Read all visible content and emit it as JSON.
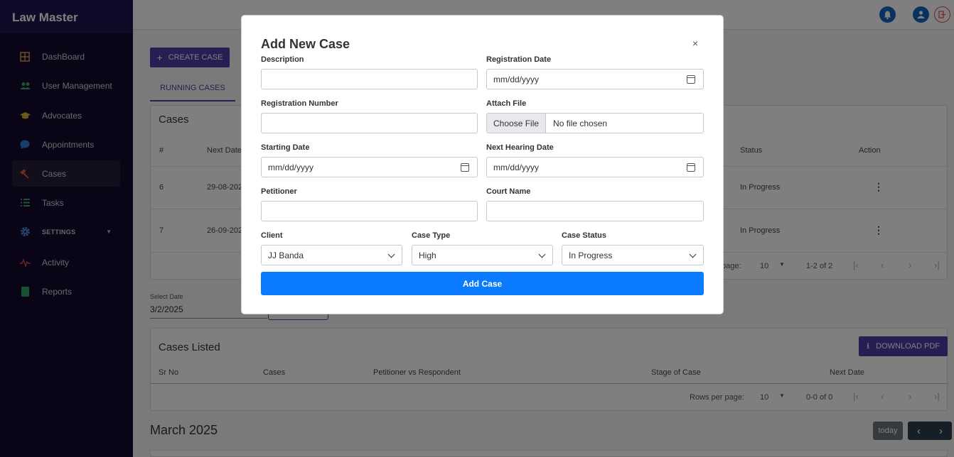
{
  "app": {
    "brand": "Law Master"
  },
  "sidebar": {
    "items": [
      {
        "label": "DashBoard",
        "icon": "dashboard-icon",
        "color": "#e0a94a"
      },
      {
        "label": "User Management",
        "icon": "users-icon",
        "color": "#3aa564"
      },
      {
        "label": "Advocates",
        "icon": "graduation-cap-icon",
        "color": "#d4b13a"
      },
      {
        "label": "Appointments",
        "icon": "chat-bubble-icon",
        "color": "#2f7fd6"
      },
      {
        "label": "Cases",
        "icon": "gavel-icon",
        "color": "#e05a3a"
      },
      {
        "label": "Tasks",
        "icon": "list-icon",
        "color": "#3aa564"
      },
      {
        "label": "SETTINGS",
        "icon": "gear-icon",
        "color": "#4d8fd8"
      },
      {
        "label": "Activity",
        "icon": "activity-icon",
        "color": "#e04a4a"
      },
      {
        "label": "Reports",
        "icon": "report-icon",
        "color": "#2fa36a"
      }
    ]
  },
  "topbar": {
    "bell_color": "#1565c0",
    "user_color": "#1565c0",
    "logout_color": "#e04a4a"
  },
  "toolbar": {
    "create_label": "CREATE CASE",
    "create_icon": "plus-icon"
  },
  "tabs": {
    "running": "RUNNING CASES"
  },
  "cases": {
    "title": "Cases",
    "headers": {
      "num": "#",
      "next_date": "Next Date",
      "status": "Status",
      "action": "Action"
    },
    "rows": [
      {
        "num": "6",
        "next_date": "29-08-202",
        "status": "In Progress"
      },
      {
        "num": "7",
        "next_date": "26-09-202",
        "status": "In Progress"
      }
    ],
    "pager": {
      "rows_label": "page:",
      "rows_value": "10",
      "range": "1-2 of 2"
    }
  },
  "date_filter": {
    "label": "Select Date",
    "value": "3/2/2025"
  },
  "cases_listed": {
    "title": "Cases Listed",
    "download_label": "DOWNLOAD PDF",
    "headers": {
      "sr": "Sr No",
      "cases": "Cases",
      "parties": "Petitioner vs Respondent",
      "stage": "Stage of Case",
      "next_date": "Next Date"
    },
    "pager": {
      "rows_label": "Rows per page:",
      "rows_value": "10",
      "range": "0-0 of 0"
    }
  },
  "calendar": {
    "month": "March 2025",
    "today_label": "today"
  },
  "modal": {
    "title": "Add New Case",
    "close": "×",
    "fields": {
      "description": {
        "label": "Description",
        "value": ""
      },
      "registration_date": {
        "label": "Registration Date",
        "value": "mm/dd/yyyy"
      },
      "registration_number": {
        "label": "Registration Number",
        "value": ""
      },
      "attach_file": {
        "label": "Attach File",
        "button": "Choose File",
        "status": "No file chosen"
      },
      "starting_date": {
        "label": "Starting Date",
        "value": "mm/dd/yyyy"
      },
      "next_hearing_date": {
        "label": "Next Hearing Date",
        "value": "mm/dd/yyyy"
      },
      "petitioner": {
        "label": "Petitioner",
        "value": ""
      },
      "court_name": {
        "label": "Court Name",
        "value": ""
      },
      "client": {
        "label": "Client",
        "value": "JJ Banda"
      },
      "case_type": {
        "label": "Case Type",
        "value": "High"
      },
      "case_status": {
        "label": "Case Status",
        "value": "In Progress"
      }
    },
    "submit_label": "Add Case",
    "submit_color": "#0a7bff"
  }
}
